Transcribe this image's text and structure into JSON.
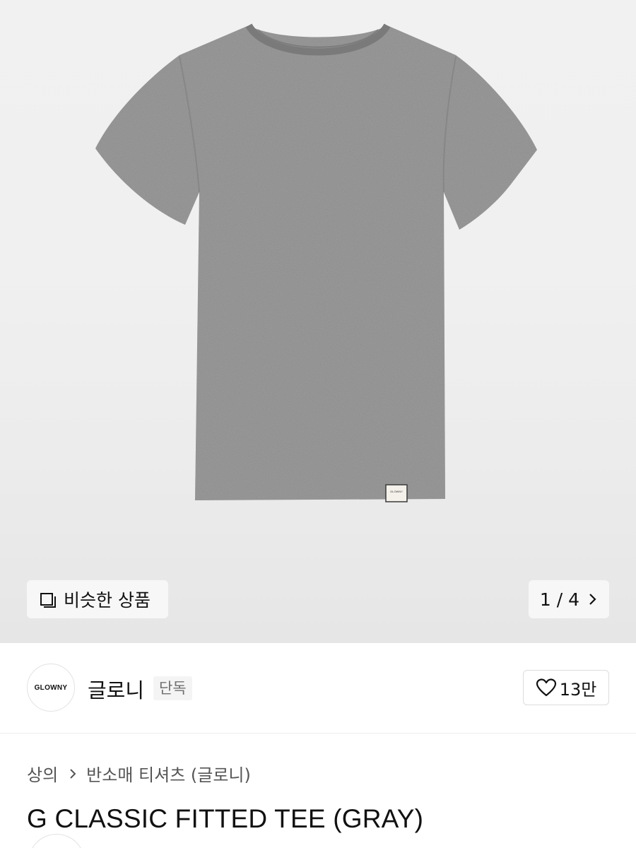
{
  "gallery": {
    "similar_label": "비슷한 상품",
    "page_counter": "1 / 4",
    "tag_text": "GLOWNY",
    "shirt_color": "#8a8a8a"
  },
  "brand": {
    "logo_text": "GLOWNY",
    "name": "글로니",
    "badge": "단독",
    "likes": "13만"
  },
  "breadcrumb": {
    "category": "상의",
    "subcategory": "반소매 티셔츠 (글로니)"
  },
  "product": {
    "title": "G CLASSIC FITTED TEE (GRAY)"
  }
}
